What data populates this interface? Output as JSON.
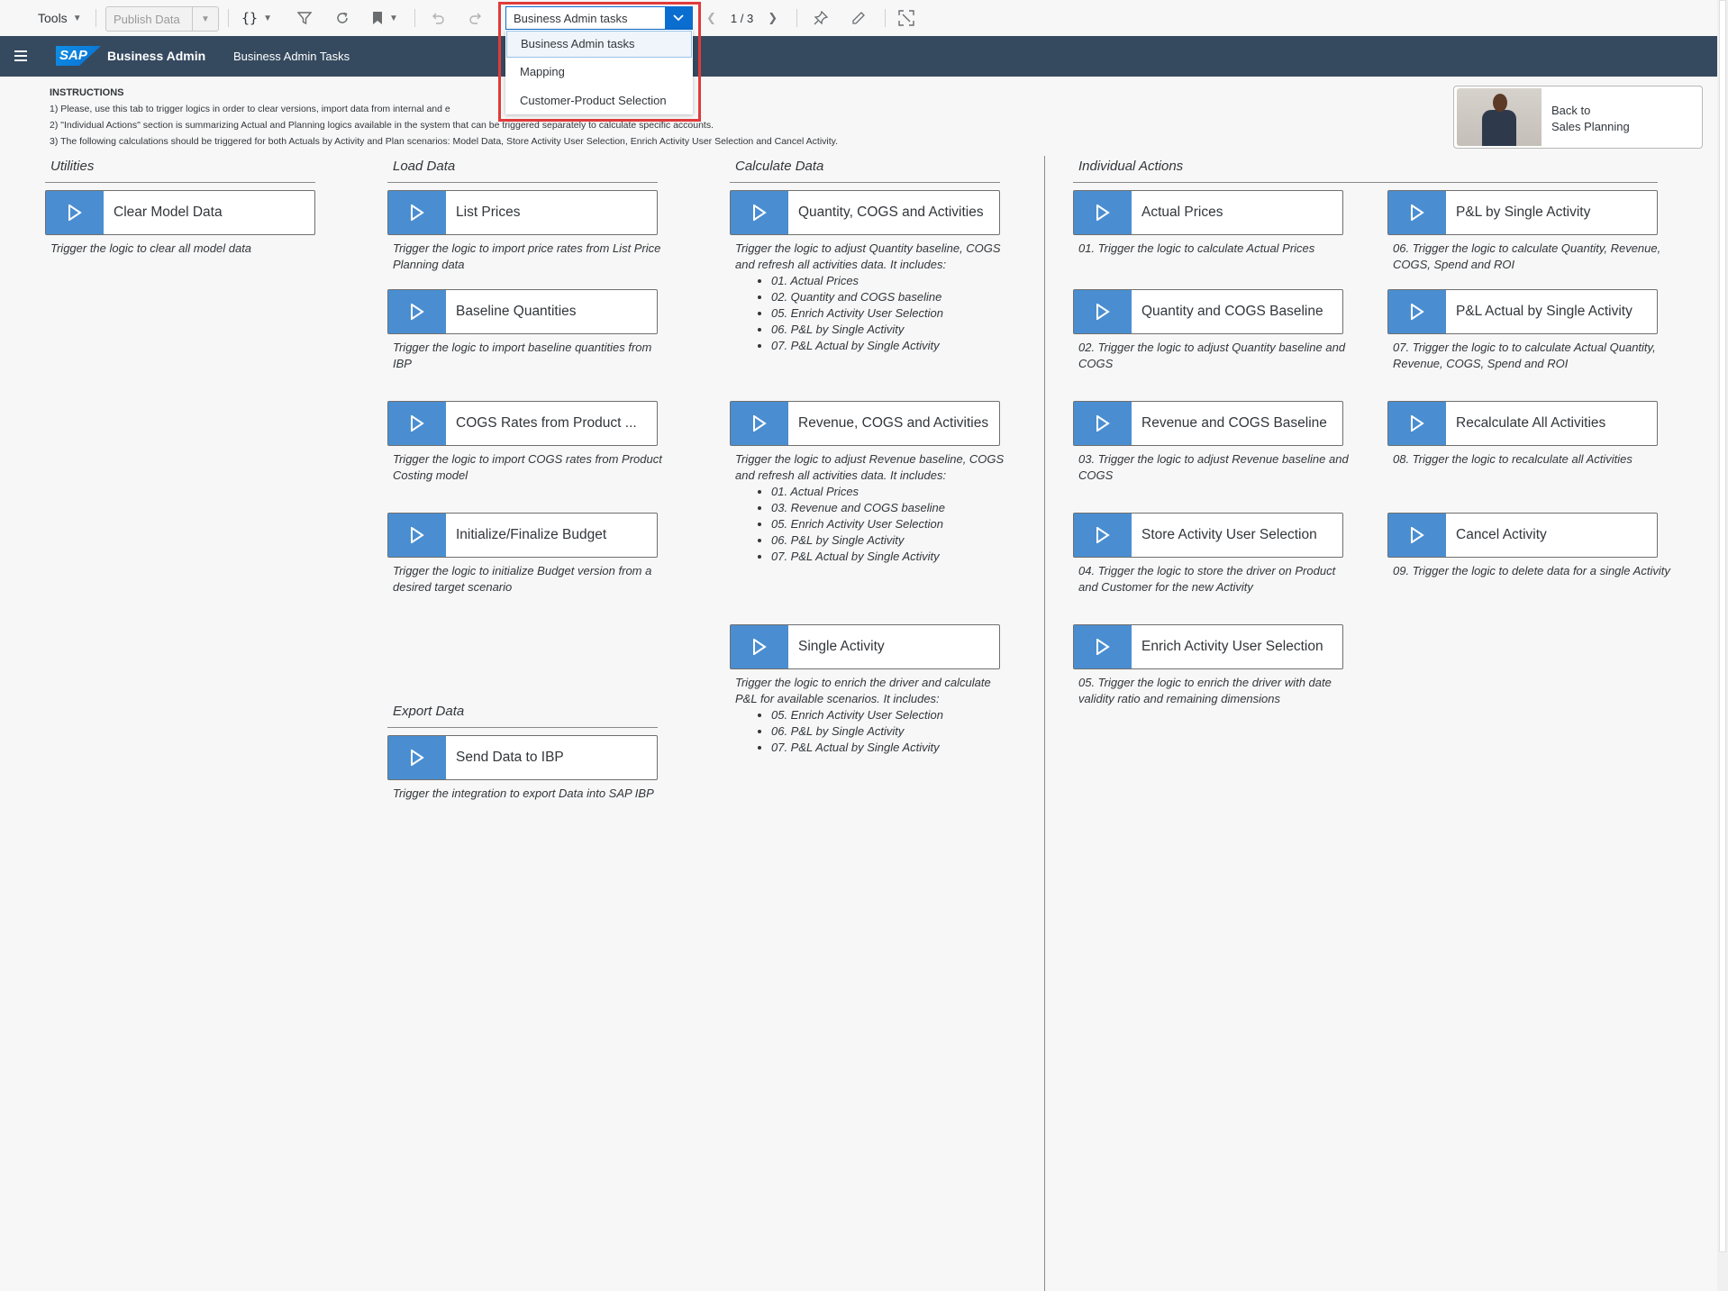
{
  "toolbar": {
    "tools_label": "Tools",
    "publish_label": "Publish Data",
    "braces_label": "{}",
    "page_select_value": "Business Admin tasks",
    "page_options": [
      "Business Admin tasks",
      "Mapping",
      "Customer-Product Selection"
    ],
    "pager_text": "1 / 3"
  },
  "shell": {
    "logo": "SAP",
    "title": "Business Admin",
    "subtitle": "Business Admin Tasks"
  },
  "instructions": {
    "heading": "INSTRUCTIONS",
    "line1": "1) Please, use this tab to trigger logics in order to clear versions, import data from internal and e",
    "line2": "2) \"Individual Actions\" section is summarizing Actual and Planning logics available in the system that can be triggered separately to calculate specific accounts.",
    "line3": "3) The following calculations should be triggered for both Actuals by Activity and Plan scenarios: Model Data, Store Activity User Selection, Enrich Activity User Selection and Cancel Activity."
  },
  "back_tile": {
    "line1": "Back to",
    "line2": "Sales Planning"
  },
  "sections": {
    "utilities": "Utilities",
    "load": "Load Data",
    "calculate": "Calculate Data",
    "individual": "Individual Actions",
    "export": "Export Data"
  },
  "buttons": {
    "clear_model": {
      "label": "Clear Model Data",
      "desc": "Trigger the logic to clear all model data"
    },
    "list_prices": {
      "label": "List Prices",
      "desc": "Trigger the logic to import price rates from List Price Planning data"
    },
    "baseline_qty": {
      "label": "Baseline Quantities",
      "desc": "Trigger the logic to import baseline quantities from IBP"
    },
    "cogs_rates": {
      "label": "COGS Rates from Product ...",
      "desc": "Trigger the logic to import COGS rates from Product Costing model"
    },
    "init_budget": {
      "label": "Initialize/Finalize Budget",
      "desc": "Trigger the logic to initialize Budget version from a desired target scenario"
    },
    "send_ibp": {
      "label": "Send Data to IBP",
      "desc": "Trigger the integration to export Data into SAP IBP"
    },
    "qty_cogs_act": {
      "label": "Quantity, COGS and Activities",
      "desc": "Trigger the logic to adjust Quantity baseline, COGS and refresh all activities data. It includes:",
      "items": [
        "01. Actual Prices",
        "02. Quantity and COGS baseline",
        "05. Enrich Activity User Selection",
        "06. P&L by Single Activity",
        "07. P&L Actual by Single Activity"
      ]
    },
    "rev_cogs_act": {
      "label": "Revenue, COGS and Activities",
      "desc": "Trigger the logic to adjust Revenue baseline, COGS and refresh all activities data. It includes:",
      "items": [
        "01. Actual Prices",
        "03. Revenue and COGS baseline",
        "05. Enrich Activity User Selection",
        "06. P&L by Single Activity",
        "07. P&L Actual by Single Activity"
      ]
    },
    "single_activity": {
      "label": "Single Activity",
      "desc": "Trigger the logic to enrich the driver and calculate P&L for available scenarios. It includes:",
      "items": [
        "05. Enrich Activity User Selection",
        "06. P&L by Single Activity",
        "07. P&L Actual by Single Activity"
      ]
    },
    "actual_prices": {
      "label": "Actual Prices",
      "desc": "01. Trigger the logic to calculate Actual Prices"
    },
    "qty_cogs_base": {
      "label": "Quantity and COGS Baseline",
      "desc": "02. Trigger the logic to adjust Quantity baseline and COGS"
    },
    "rev_cogs_base": {
      "label": "Revenue and COGS Baseline",
      "desc": "03. Trigger the logic to adjust Revenue baseline and COGS"
    },
    "store_activity": {
      "label": "Store Activity User Selection",
      "desc": "04. Trigger the logic to store the driver on Product and Customer for the new Activity"
    },
    "enrich_activity": {
      "label": "Enrich Activity User Selection",
      "desc": "05. Trigger the logic to enrich the driver with date validity ratio and remaining dimensions"
    },
    "pl_single": {
      "label": "P&L by Single Activity",
      "desc": "06. Trigger the logic to calculate Quantity, Revenue, COGS, Spend and ROI"
    },
    "pl_actual_single": {
      "label": "P&L Actual by Single Activity",
      "desc": "07. Trigger the logic to to calculate Actual Quantity, Revenue, COGS, Spend and ROI"
    },
    "recalc_all": {
      "label": "Recalculate All Activities",
      "desc": "08. Trigger the logic to recalculate all Activities"
    },
    "cancel_activity": {
      "label": "Cancel Activity",
      "desc": "09. Trigger the logic to delete data for a single Activity"
    }
  },
  "colors": {
    "shell": "#354a5f",
    "accent": "#0a6ed1",
    "play_button": "#4a8ed1",
    "highlight": "#e03b3b"
  }
}
